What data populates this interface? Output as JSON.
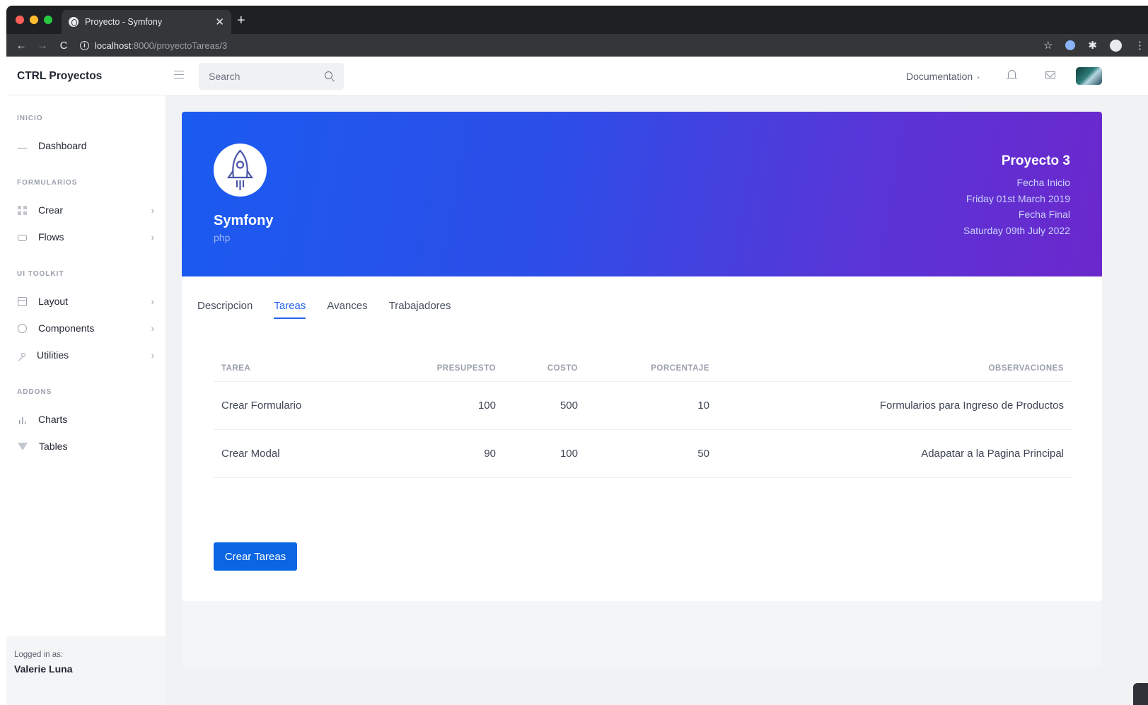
{
  "browser": {
    "tab_title": "Proyecto - Symfony",
    "tab_close": "✕",
    "new_tab": "+",
    "url_host": "localhost",
    "url_path": ":8000/proyectoTareas/3",
    "back": "←",
    "forward": "→",
    "reload": "C",
    "star": "☆",
    "more": "⋮"
  },
  "appbar": {
    "brand": "CTRL Proyectos",
    "search_placeholder": "Search",
    "documentation": "Documentation",
    "documentation_chevron": "›"
  },
  "sidebar": {
    "sections": [
      {
        "label": "INICIO",
        "items": [
          {
            "label": "Dashboard",
            "icon": "activity-icon",
            "chevron": ""
          }
        ]
      },
      {
        "label": "FORMULARIOS",
        "items": [
          {
            "label": "Crear",
            "icon": "grid-icon",
            "chevron": "›"
          },
          {
            "label": "Flows",
            "icon": "repeat-icon",
            "chevron": "›"
          }
        ]
      },
      {
        "label": "UI TOOLKIT",
        "items": [
          {
            "label": "Layout",
            "icon": "layout-icon",
            "chevron": "›"
          },
          {
            "label": "Components",
            "icon": "box-icon",
            "chevron": "›"
          },
          {
            "label": "Utilities",
            "icon": "tool-icon",
            "chevron": "›"
          }
        ]
      },
      {
        "label": "ADDONS",
        "items": [
          {
            "label": "Charts",
            "icon": "bar-chart-icon",
            "chevron": ""
          },
          {
            "label": "Tables",
            "icon": "filter-icon",
            "chevron": ""
          }
        ]
      }
    ],
    "logged_in_label": "Logged in as:",
    "user_name": "Valerie Luna"
  },
  "project": {
    "name": "Symfony",
    "language": "php",
    "title": "Proyecto 3",
    "start_label": "Fecha Inicio",
    "start_date": "Friday 01st March 2019",
    "end_label": "Fecha Final",
    "end_date": "Saturday 09th July 2022"
  },
  "tabs": [
    "Descripcion",
    "Tareas",
    "Avances",
    "Trabajadores"
  ],
  "active_tab": "Tareas",
  "table": {
    "headers": [
      "TAREA",
      "PRESUPESTO",
      "COSTO",
      "PORCENTAJE",
      "OBSERVACIONES"
    ],
    "rows": [
      [
        "Crear Formulario",
        "100",
        "500",
        "10",
        "Formularios para Ingreso de Productos"
      ],
      [
        "Crear Modal",
        "90",
        "100",
        "50",
        "Adapatar a la Pagina Principal"
      ]
    ]
  },
  "create_button": "Crear Tareas",
  "colors": {
    "accent": "#2563eb",
    "button": "#0b66e4",
    "hero_start": "#1a5bf0",
    "hero_end": "#6b28cc"
  }
}
